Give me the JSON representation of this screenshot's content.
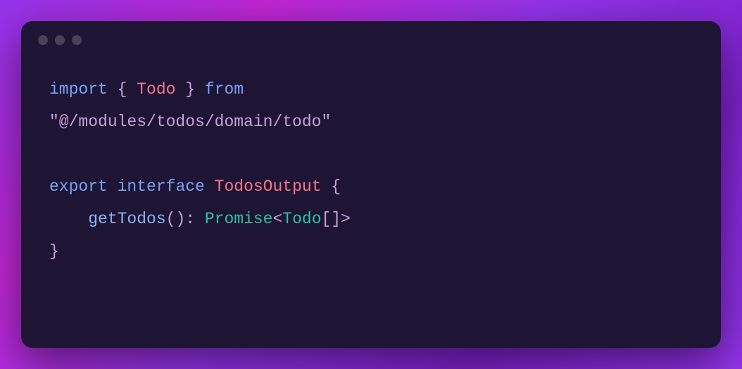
{
  "code": {
    "line1": {
      "import": "import",
      "lbrace": " { ",
      "type": "Todo",
      "rbrace": " } ",
      "from": "from"
    },
    "line2": {
      "string": "\"@/modules/todos/domain/todo\""
    },
    "line4": {
      "export": "export",
      "interface": " interface ",
      "name": "TodosOutput",
      "lbrace": " {"
    },
    "line5": {
      "indent": "    ",
      "method": "getTodos",
      "parens": "(): ",
      "promise": "Promise",
      "lt": "<",
      "type": "Todo",
      "brackets": "[]>"
    },
    "line6": {
      "rbrace": "}"
    }
  }
}
